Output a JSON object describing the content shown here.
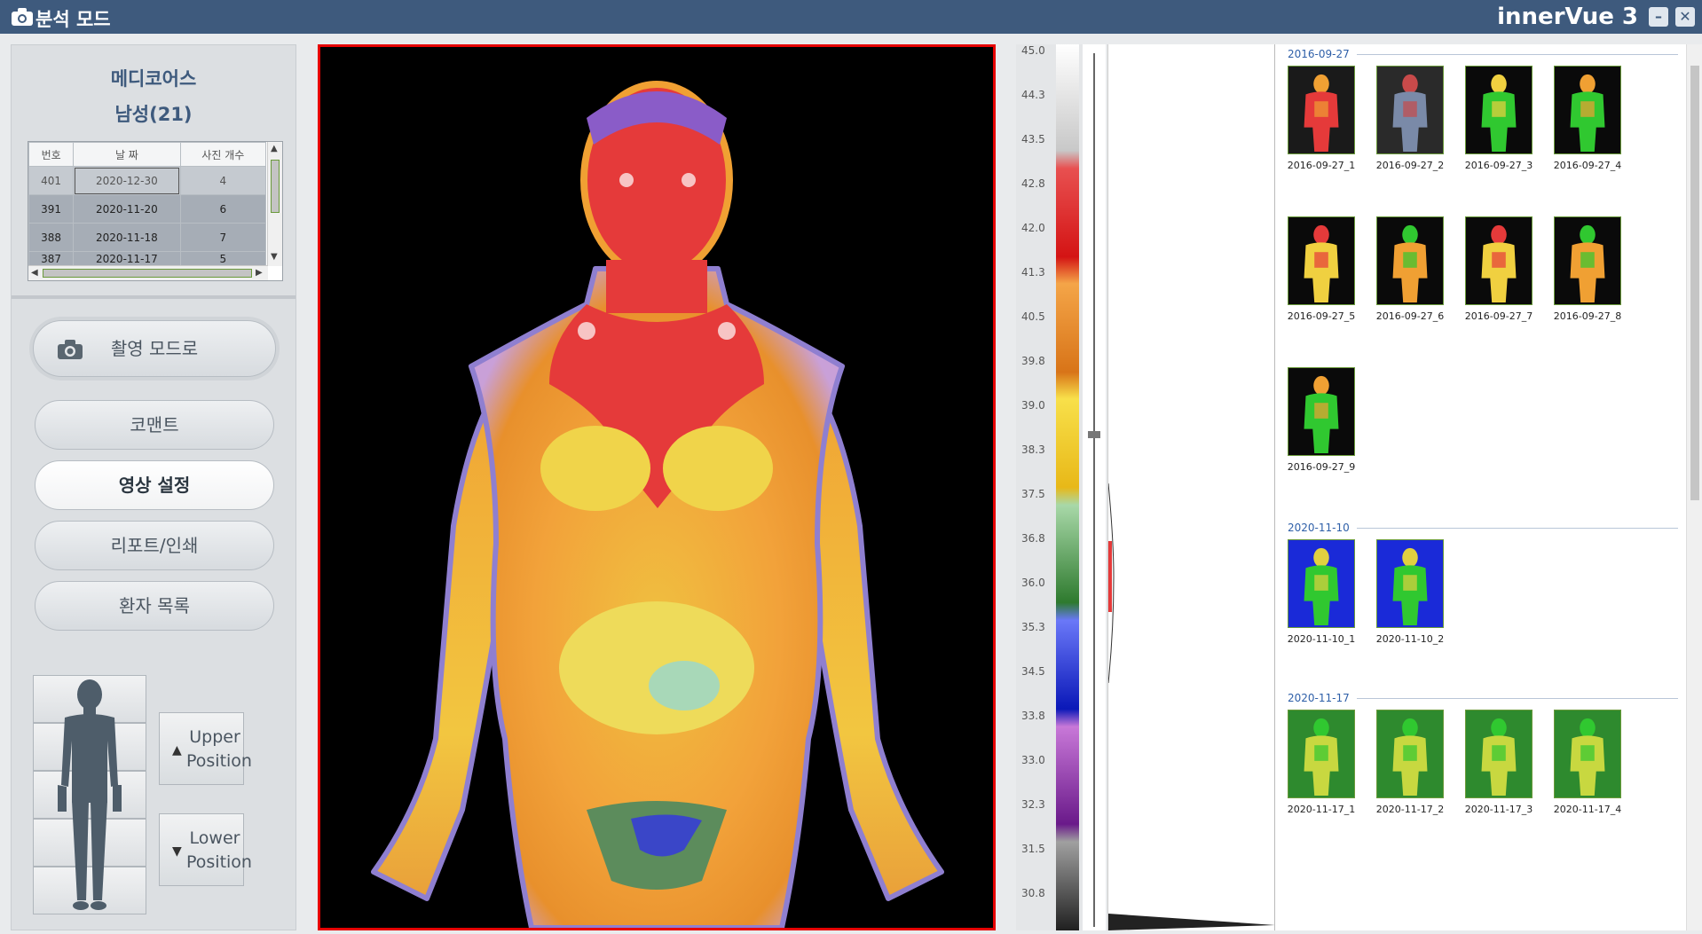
{
  "titlebar": {
    "title": "분석 모드",
    "brand": "innerVue 3",
    "minimize": "–",
    "close": "✕"
  },
  "patient": {
    "hospital": "메디코어스",
    "info": "남성(21)"
  },
  "records": {
    "headers": [
      "번호",
      "날 짜",
      "사진 개수"
    ],
    "rows": [
      [
        "401",
        "2020-12-30",
        "4"
      ],
      [
        "391",
        "2020-11-20",
        "6"
      ],
      [
        "388",
        "2020-11-18",
        "7"
      ],
      [
        "387",
        "2020-11-17",
        "5"
      ]
    ]
  },
  "buttons": {
    "capture": "촬영 모드로",
    "comment": "코맨트",
    "image_settings": "영상 설정",
    "report": "리포트/인쇄",
    "patient_list": "환자 목록"
  },
  "position": {
    "upper_line1": "Upper",
    "upper_line2": "Position",
    "lower_line1": "Lower",
    "lower_line2": "Position"
  },
  "scale": [
    "45.0",
    "44.3",
    "43.5",
    "42.8",
    "42.0",
    "41.3",
    "40.5",
    "39.8",
    "39.0",
    "38.3",
    "37.5",
    "36.8",
    "36.0",
    "35.3",
    "34.5",
    "33.8",
    "33.0",
    "32.3",
    "31.5",
    "30.8"
  ],
  "gallery": {
    "groups": [
      {
        "date": "2016-09-27",
        "items": [
          "2016-09-27_1",
          "2016-09-27_2",
          "2016-09-27_3",
          "2016-09-27_4",
          "2016-09-27_5",
          "2016-09-27_6",
          "2016-09-27_7",
          "2016-09-27_8",
          "2016-09-27_9"
        ]
      },
      {
        "date": "2020-11-10",
        "items": [
          "2020-11-10_1",
          "2020-11-10_2"
        ]
      },
      {
        "date": "2020-11-17",
        "items": [
          "2020-11-17_1",
          "2020-11-17_2",
          "2020-11-17_3",
          "2020-11-17_4"
        ]
      }
    ]
  },
  "colors": {
    "titlebar": "#3e5a7d",
    "accent_red": "#e60000",
    "group_date": "#2e5fa8"
  }
}
